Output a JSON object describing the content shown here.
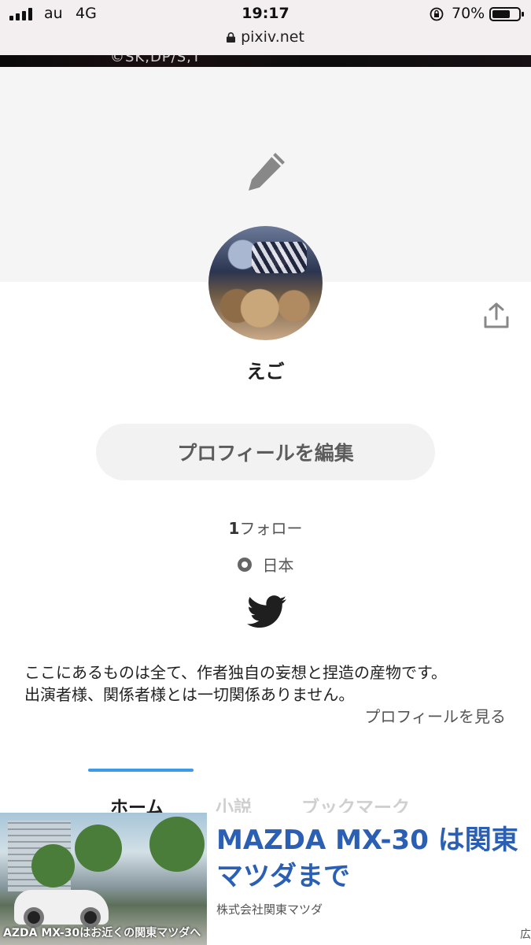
{
  "status_bar": {
    "carrier": "au",
    "network": "4G",
    "time": "19:17",
    "battery_text": "70%",
    "battery_level": 0.7
  },
  "url_bar": {
    "domain": "pixiv.net"
  },
  "cover": {
    "credit_text": "©SK,DP/S,T"
  },
  "profile": {
    "username": "えご",
    "edit_button_label": "プロフィールを編集",
    "follow_count": "1",
    "follow_label": "フォロー",
    "location": "日本",
    "bio_lines": [
      "ここにあるものは全て、作者独自の妄想と捏造の産物です。",
      "出演者様、関係者様とは一切関係ありません。"
    ],
    "view_profile_link": "プロフィールを見る"
  },
  "tabs": [
    {
      "label": "ホーム",
      "active": true
    },
    {
      "label": "小説",
      "active": false
    },
    {
      "label": "ブックマーク",
      "active": false
    }
  ],
  "ad": {
    "headline": "MAZDA MX-30 は関東マツダまで",
    "advertiser": "株式会社関東マツダ",
    "image_caption": "AZDA MX-30はお近くの関東マツダへ",
    "label": "広"
  },
  "colors": {
    "accent_tab": "#3d9ae8",
    "ad_headline": "#2a5fb3"
  }
}
